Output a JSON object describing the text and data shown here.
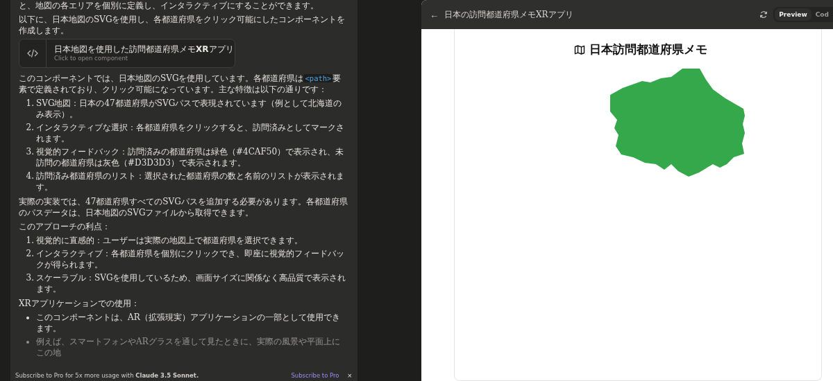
{
  "chat": {
    "blocks": [
      {
        "kind": "paragraph",
        "text": "と、地図の各エリアを個別に定義し、インタラクティブにすることができます。"
      },
      {
        "kind": "paragraph",
        "text": "以下に、日本地図のSVGを使用し、各都道府県をクリック可能にしたコンポーネントを作成します。"
      },
      {
        "kind": "artifact",
        "title": "日本地図を使用した訪問都道府県メモ**XR**アプリ",
        "subtitle": "Click to open component"
      },
      {
        "kind": "segments",
        "parts": [
          {
            "kind": "text",
            "text": "このコンポーネントでは、日本地図のSVGを使用しています。各都道府県は"
          },
          {
            "kind": "code",
            "text": "<path>"
          },
          {
            "kind": "text",
            "text": "要素で定義されており、クリック可能になっています。主な特徴は以下の通りです："
          }
        ]
      },
      {
        "kind": "ordered",
        "items": [
          {
            "number": "1.",
            "text": "SVG地図：日本の47都道府県がSVGパスで表現されています（例として北海道のみ表示）。"
          },
          {
            "number": "2.",
            "text": "インタラクティブな選択：各都道府県をクリックすると、訪問済みとしてマークされます。"
          },
          {
            "number": "3.",
            "text": "視覚的フィードバック：訪問済みの都道府県は緑色（#4CAF50）で表示され、未訪問の都道府県は灰色（#D3D3D3）で表示されます。"
          },
          {
            "number": "4.",
            "text": "訪問済み都道府県のリスト：選択された都道府県の数と名前のリストが表示されます。"
          }
        ]
      },
      {
        "kind": "paragraph",
        "text": "実際の実装では、47都道府県すべてのSVGパスを追加する必要があります。各都道府県のパスデータは、日本地図のSVGファイルから取得できます。"
      },
      {
        "kind": "paragraph",
        "text": "このアプローチの利点："
      },
      {
        "kind": "ordered",
        "items": [
          {
            "number": "1.",
            "text": "視覚的に直感的：ユーザーは実際の地図上で都道府県を選択できます。"
          },
          {
            "number": "2.",
            "text": "インタラクティブ：各都道府県を個別にクリックでき、即座に視覚的フィードバックが得られます。"
          },
          {
            "number": "3.",
            "text": "スケーラブル：SVGを使用しているため、画面サイズに関係なく高品質で表示されます。"
          }
        ]
      },
      {
        "kind": "paragraph",
        "text": "XRアプリケーションでの使用："
      },
      {
        "kind": "bullets",
        "items": [
          "このコンポーネントは、AR（拡張現実）アプリケーションの一部として使用できます。",
          "例えば、スマートフォンやARグラスを通して見たときに、実際の風景や平面上にこの地"
        ]
      }
    ],
    "banner": {
      "text": "Subscribe to Pro for 5x more usage with **Claude 3.5 Sonnet.**",
      "link": "Subscribe to Pro",
      "close": "×"
    }
  },
  "preview": {
    "back": "←",
    "title": "日本の訪問都道府県メモXRアプリ",
    "tabs": [
      {
        "label": "Preview",
        "selected": true
      },
      {
        "label": "Cod",
        "selected": false
      }
    ],
    "app_title": "日本訪問都道府県メモ",
    "prefectures": [
      {
        "visited": true
      }
    ]
  }
}
